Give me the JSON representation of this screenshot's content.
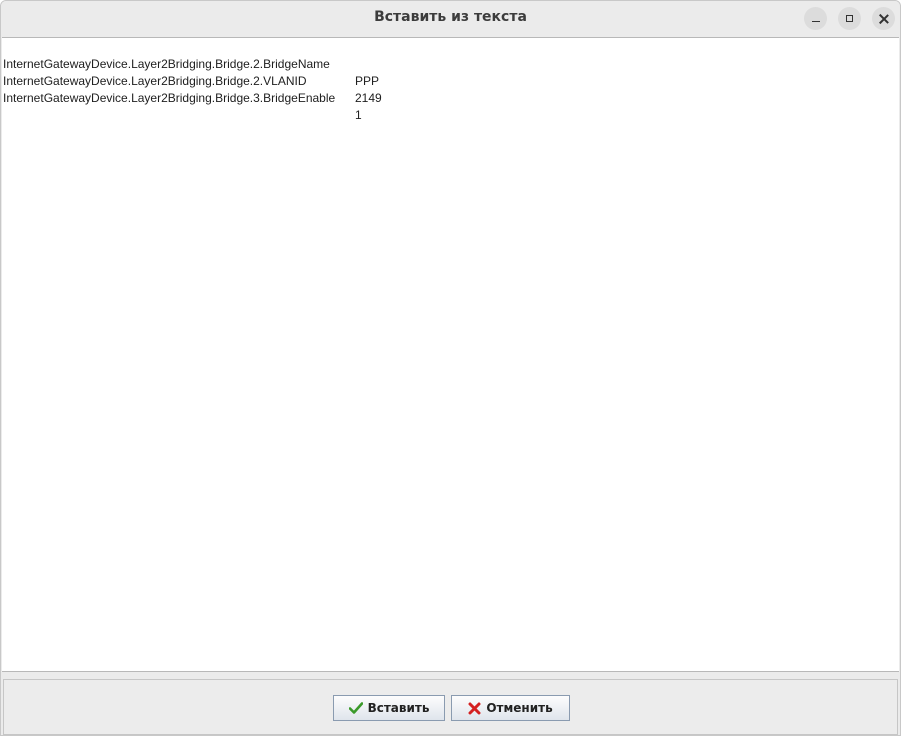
{
  "window": {
    "title": "Вставить из текста"
  },
  "controls": {
    "minimize_icon": "minimize-icon",
    "maximize_icon": "maximize-icon",
    "close_icon": "close-icon"
  },
  "content": {
    "lines": [
      {
        "key": "InternetGatewayDevice.Layer2Bridging.Bridge.2.BridgeName",
        "value": "PPP"
      },
      {
        "key": "InternetGatewayDevice.Layer2Bridging.Bridge.2.VLANID",
        "value": "2149"
      },
      {
        "key": "InternetGatewayDevice.Layer2Bridging.Bridge.3.BridgeEnable",
        "value": "1"
      }
    ]
  },
  "buttons": {
    "insert_label": "Вставить",
    "insert_icon": "checkmark-icon",
    "cancel_label": "Отменить",
    "cancel_icon": "red-x-icon"
  },
  "colors": {
    "check_green": "#3a9a2a",
    "cancel_red": "#d42020"
  }
}
